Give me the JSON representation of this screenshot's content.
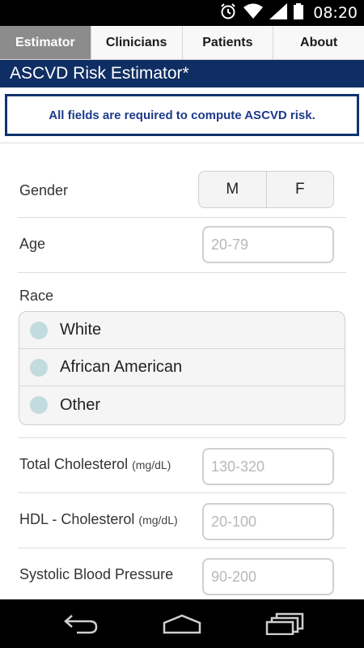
{
  "status_bar": {
    "time": "08:20",
    "icons": [
      "alarm-icon",
      "wifi-icon",
      "signal-icon",
      "battery-icon"
    ]
  },
  "tabs": [
    {
      "label": "Estimator",
      "active": true
    },
    {
      "label": "Clinicians",
      "active": false
    },
    {
      "label": "Patients",
      "active": false
    },
    {
      "label": "About",
      "active": false
    }
  ],
  "title": "ASCVD Risk Estimator*",
  "alert": "All fields are required to compute ASCVD risk.",
  "form": {
    "gender": {
      "label": "Gender",
      "options": [
        "M",
        "F"
      ]
    },
    "age": {
      "label": "Age",
      "placeholder": "20-79"
    },
    "race": {
      "label": "Race",
      "options": [
        "White",
        "African American",
        "Other"
      ]
    },
    "total_cholesterol": {
      "label": "Total Cholesterol",
      "unit": "(mg/dL)",
      "placeholder": "130-320"
    },
    "hdl_cholesterol": {
      "label": "HDL - Cholesterol",
      "unit": "(mg/dL)",
      "placeholder": "20-100"
    },
    "systolic_bp": {
      "label": "Systolic Blood Pressure",
      "placeholder": "90-200"
    }
  },
  "nav_bar": {
    "buttons": [
      "back-icon",
      "home-icon",
      "recent-apps-icon"
    ]
  },
  "colors": {
    "title_bar": "#0f2e63",
    "alert_border": "#10336d",
    "alert_text": "#1d3a8a",
    "active_tab": "#8c8c8c",
    "radio": "#c2dbdf"
  }
}
